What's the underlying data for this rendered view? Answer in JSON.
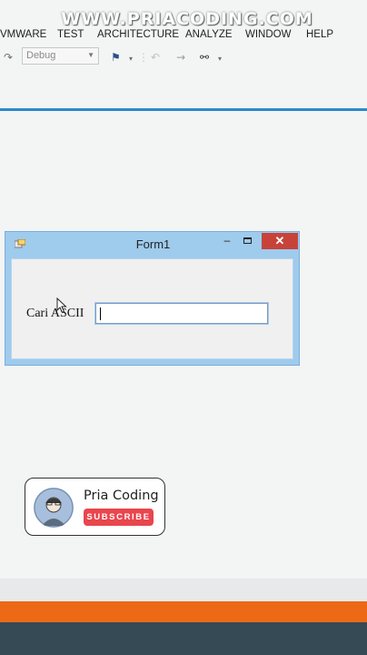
{
  "watermark": "WWW.PRIACODING.COM",
  "menu": {
    "items": [
      "VMWARE",
      "TEST",
      "ARCHITECTURE",
      "ANALYZE",
      "WINDOW",
      "HELP"
    ]
  },
  "toolbar": {
    "configuration": "Debug"
  },
  "form": {
    "title": "Form1",
    "minimize": "–",
    "close": "✕",
    "label": "Cari ASCII",
    "input_value": ""
  },
  "badge": {
    "channel_name": "Pria Coding",
    "subscribe_label": "SUBSCRIBE"
  },
  "colors": {
    "accent_blue": "#2c88c9",
    "form_frame": "#9fcbed",
    "close_red": "#c7433a",
    "subscribe_red": "#e9464d",
    "footer_orange": "#ec6a15",
    "footer_dark": "#364a56"
  }
}
